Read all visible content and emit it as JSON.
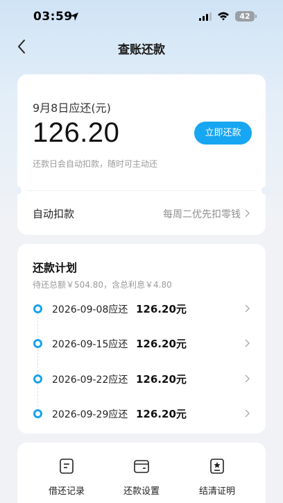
{
  "status_bar": {
    "time": "03:59",
    "battery": "42"
  },
  "nav": {
    "title": "查账还款"
  },
  "due_card": {
    "label": "9月8日应还(元)",
    "amount": "126.20",
    "repay_button": "立即还款",
    "hint": "还款日会自动扣款，随时可主动还",
    "auto_debit_label": "自动扣款",
    "auto_debit_value": "每周二优先扣零钱"
  },
  "plan": {
    "title": "还款计划",
    "summary": "待还总额￥504.80，含总利息￥4.80",
    "items": [
      {
        "date": "2026-09-08应还",
        "amount": "126.20元"
      },
      {
        "date": "2026-09-15应还",
        "amount": "126.20元"
      },
      {
        "date": "2026-09-22应还",
        "amount": "126.20元"
      },
      {
        "date": "2026-09-29应还",
        "amount": "126.20元"
      }
    ]
  },
  "actions": [
    {
      "label": "借还记录",
      "icon": "document-icon"
    },
    {
      "label": "还款设置",
      "icon": "wallet-icon"
    },
    {
      "label": "结清证明",
      "icon": "certificate-icon"
    }
  ],
  "colors": {
    "accent": "#17a6f2",
    "timeline_dot": "#19a3ec"
  }
}
